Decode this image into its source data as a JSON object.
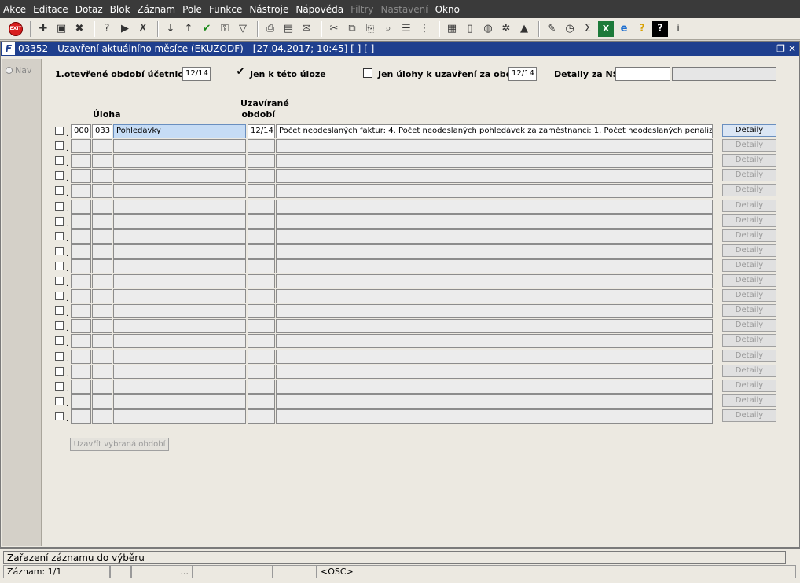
{
  "menubar": {
    "items": [
      {
        "label": "Akce",
        "disabled": false
      },
      {
        "label": "Editace",
        "disabled": false
      },
      {
        "label": "Dotaz",
        "disabled": false
      },
      {
        "label": "Blok",
        "disabled": false
      },
      {
        "label": "Záznam",
        "disabled": false
      },
      {
        "label": "Pole",
        "disabled": false
      },
      {
        "label": "Funkce",
        "disabled": false
      },
      {
        "label": "Nástroje",
        "disabled": false
      },
      {
        "label": "Nápověda",
        "disabled": false
      },
      {
        "label": "Filtry",
        "disabled": true
      },
      {
        "label": "Nastavení",
        "disabled": true
      },
      {
        "label": "Okno",
        "disabled": false
      }
    ]
  },
  "toolbar": {
    "exit_label": "EXIT",
    "icons": [
      "exit-icon",
      "sep",
      "new-record-icon",
      "save-icon",
      "delete-record-icon",
      "sep",
      "query-enter-icon",
      "query-execute-icon",
      "query-cancel-icon",
      "sep",
      "sort-asc-icon",
      "sort-desc-icon",
      "checkmark-icon",
      "key-icon",
      "filter-icon",
      "sep",
      "print-icon",
      "print-preview-icon",
      "email-icon",
      "sep",
      "cut-icon",
      "copy-icon",
      "paste-icon",
      "search-icon",
      "list-icon",
      "tree-icon",
      "sep",
      "clipboard-icon",
      "document-icon",
      "globe-icon",
      "gear-icon",
      "chart-icon",
      "sep",
      "edit-icon",
      "clock-icon",
      "sum-icon",
      "excel-icon",
      "ie-icon",
      "help-icon",
      "context-help-icon",
      "info-icon"
    ]
  },
  "window": {
    "title": "03352 - Uzavření aktuálního měsíce (EKUZODF) - [27.04.2017; 10:45]  [ ] [ ]"
  },
  "nav": {
    "label": "Nav"
  },
  "filters": {
    "period_label": "1.otevřené období účetnictví",
    "period_value": "12/14",
    "only_task_label": "Jen k této úloze",
    "only_task_checked": true,
    "only_closing_label": "Jen úlohy k uzavření za obd.",
    "only_closing_checked": false,
    "only_closing_value": "12/14",
    "details_ns_label": "Detaily za NS",
    "details_ns_value": "",
    "details_ns_value2": ""
  },
  "grid": {
    "header_task": "Úloha",
    "header_period": "Uzavírané období",
    "rows": [
      {
        "c1": "000",
        "c2": "033",
        "task": "Pohledávky",
        "period": "12/14",
        "info": "Počet neodeslaných faktur: 4. Počet neodeslaných pohledávek za zaměstnanci: 1. Počet neodeslaných penalizačn",
        "button": "Detaily"
      },
      {
        "c1": "",
        "c2": "",
        "task": "",
        "period": "",
        "info": "",
        "button": "Detaily"
      },
      {
        "c1": "",
        "c2": "",
        "task": "",
        "period": "",
        "info": "",
        "button": "Detaily"
      },
      {
        "c1": "",
        "c2": "",
        "task": "",
        "period": "",
        "info": "",
        "button": "Detaily"
      },
      {
        "c1": "",
        "c2": "",
        "task": "",
        "period": "",
        "info": "",
        "button": "Detaily"
      },
      {
        "c1": "",
        "c2": "",
        "task": "",
        "period": "",
        "info": "",
        "button": "Detaily"
      },
      {
        "c1": "",
        "c2": "",
        "task": "",
        "period": "",
        "info": "",
        "button": "Detaily"
      },
      {
        "c1": "",
        "c2": "",
        "task": "",
        "period": "",
        "info": "",
        "button": "Detaily"
      },
      {
        "c1": "",
        "c2": "",
        "task": "",
        "period": "",
        "info": "",
        "button": "Detaily"
      },
      {
        "c1": "",
        "c2": "",
        "task": "",
        "period": "",
        "info": "",
        "button": "Detaily"
      },
      {
        "c1": "",
        "c2": "",
        "task": "",
        "period": "",
        "info": "",
        "button": "Detaily"
      },
      {
        "c1": "",
        "c2": "",
        "task": "",
        "period": "",
        "info": "",
        "button": "Detaily"
      },
      {
        "c1": "",
        "c2": "",
        "task": "",
        "period": "",
        "info": "",
        "button": "Detaily"
      },
      {
        "c1": "",
        "c2": "",
        "task": "",
        "period": "",
        "info": "",
        "button": "Detaily"
      },
      {
        "c1": "",
        "c2": "",
        "task": "",
        "period": "",
        "info": "",
        "button": "Detaily"
      },
      {
        "c1": "",
        "c2": "",
        "task": "",
        "period": "",
        "info": "",
        "button": "Detaily"
      },
      {
        "c1": "",
        "c2": "",
        "task": "",
        "period": "",
        "info": "",
        "button": "Detaily"
      },
      {
        "c1": "",
        "c2": "",
        "task": "",
        "period": "",
        "info": "",
        "button": "Detaily"
      },
      {
        "c1": "",
        "c2": "",
        "task": "",
        "period": "",
        "info": "",
        "button": "Detaily"
      },
      {
        "c1": "",
        "c2": "",
        "task": "",
        "period": "",
        "info": "",
        "button": "Detaily"
      }
    ]
  },
  "actions": {
    "close_selected": "Uzavřít vybraná období"
  },
  "status": {
    "message": "Zařazení záznamu do výběru",
    "record": "Záznam: 1/1",
    "seg_dots": "...",
    "mode": "<OSC>"
  }
}
